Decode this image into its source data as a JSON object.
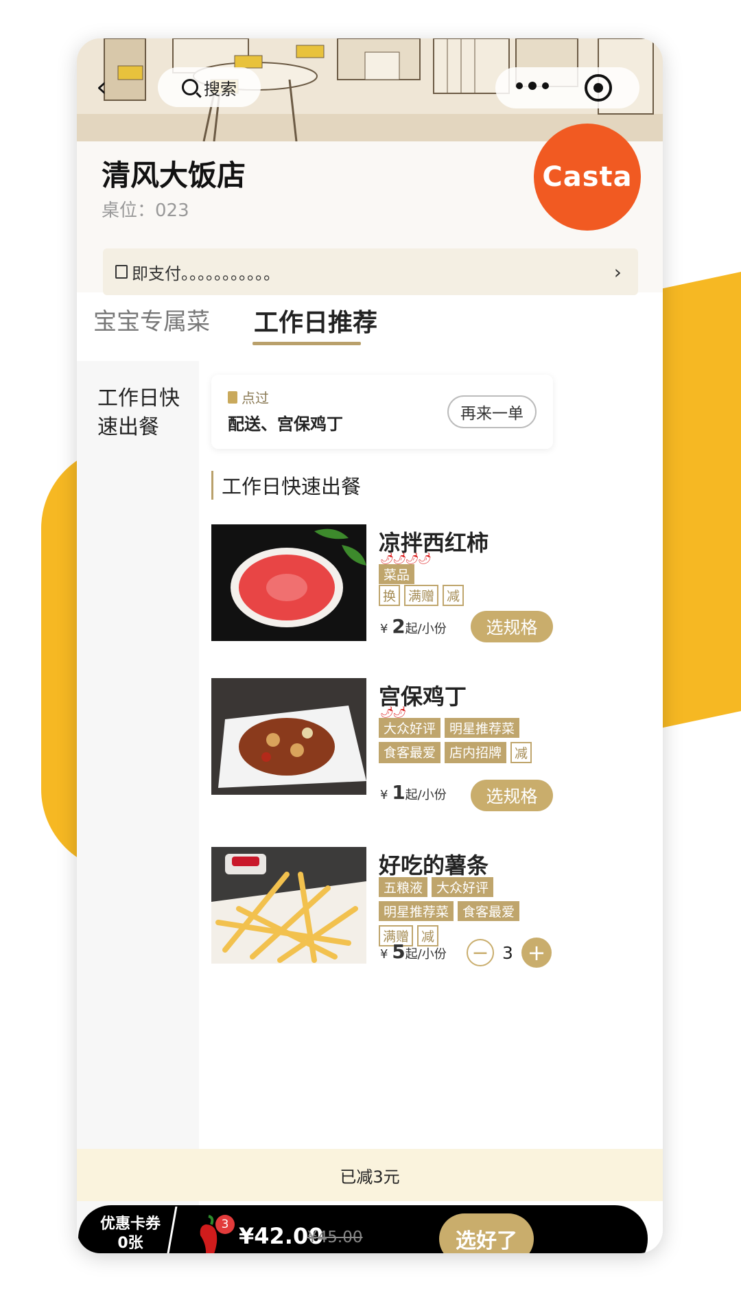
{
  "nav": {
    "back_icon": "back-chevron-icon",
    "search_label": "搜索",
    "more_icon": "more-dots-icon",
    "close_icon": "target-circle-icon"
  },
  "store": {
    "name": "清风大饭店",
    "table_label": "桌位：023",
    "logo_text": "Casta",
    "logo_color": "#f15a22"
  },
  "notice": {
    "text": "即支付。。。。。。。。。。。",
    "icon": "speaker-icon",
    "arrow_icon": "chevron-right-icon"
  },
  "tabs": [
    {
      "label": "宝宝专属菜",
      "active": false
    },
    {
      "label": "工作日推荐",
      "active": true
    }
  ],
  "sidebar": {
    "items": [
      {
        "label": "工作日快速出餐",
        "active": true
      }
    ]
  },
  "history": {
    "tag": "点过",
    "items": "配送、宫保鸡丁",
    "reorder_label": "再来一单"
  },
  "category_title": "工作日快速出餐",
  "dishes": [
    {
      "name": "凉拌西红柿",
      "chili": "🌶🌶🌶🌶",
      "tags_filled": [
        "菜品"
      ],
      "tags_outline": [
        "换",
        "满赠",
        "减"
      ],
      "currency": "¥",
      "price": "2",
      "unit": "起/小份",
      "action": "选规格"
    },
    {
      "name": "宫保鸡丁",
      "chili": "🌶🌶",
      "tags_filled": [
        "大众好评",
        "明星推荐菜",
        "食客最爱",
        "店内招牌"
      ],
      "tags_outline": [
        "减"
      ],
      "currency": "¥",
      "price": "1",
      "unit": "起/小份",
      "action": "选规格"
    },
    {
      "name": "好吃的薯条",
      "chili": "",
      "tags_filled": [
        "五粮液",
        "大众好评",
        "明星推荐菜",
        "食客最爱"
      ],
      "tags_outline": [
        "满赠",
        "减"
      ],
      "currency": "¥",
      "price": "5",
      "unit": "起/小份",
      "quantity": "3"
    }
  ],
  "discount_bar": "已减3元",
  "cart": {
    "coupon_line1": "优惠卡券",
    "coupon_line2": "0张",
    "badge": "3",
    "total": "¥42.00",
    "original": "¥45.00",
    "checkout_label": "选好了"
  },
  "colors": {
    "accent": "#c9ad6c",
    "decor": "#f6b823",
    "cart_bg": "#000000"
  }
}
